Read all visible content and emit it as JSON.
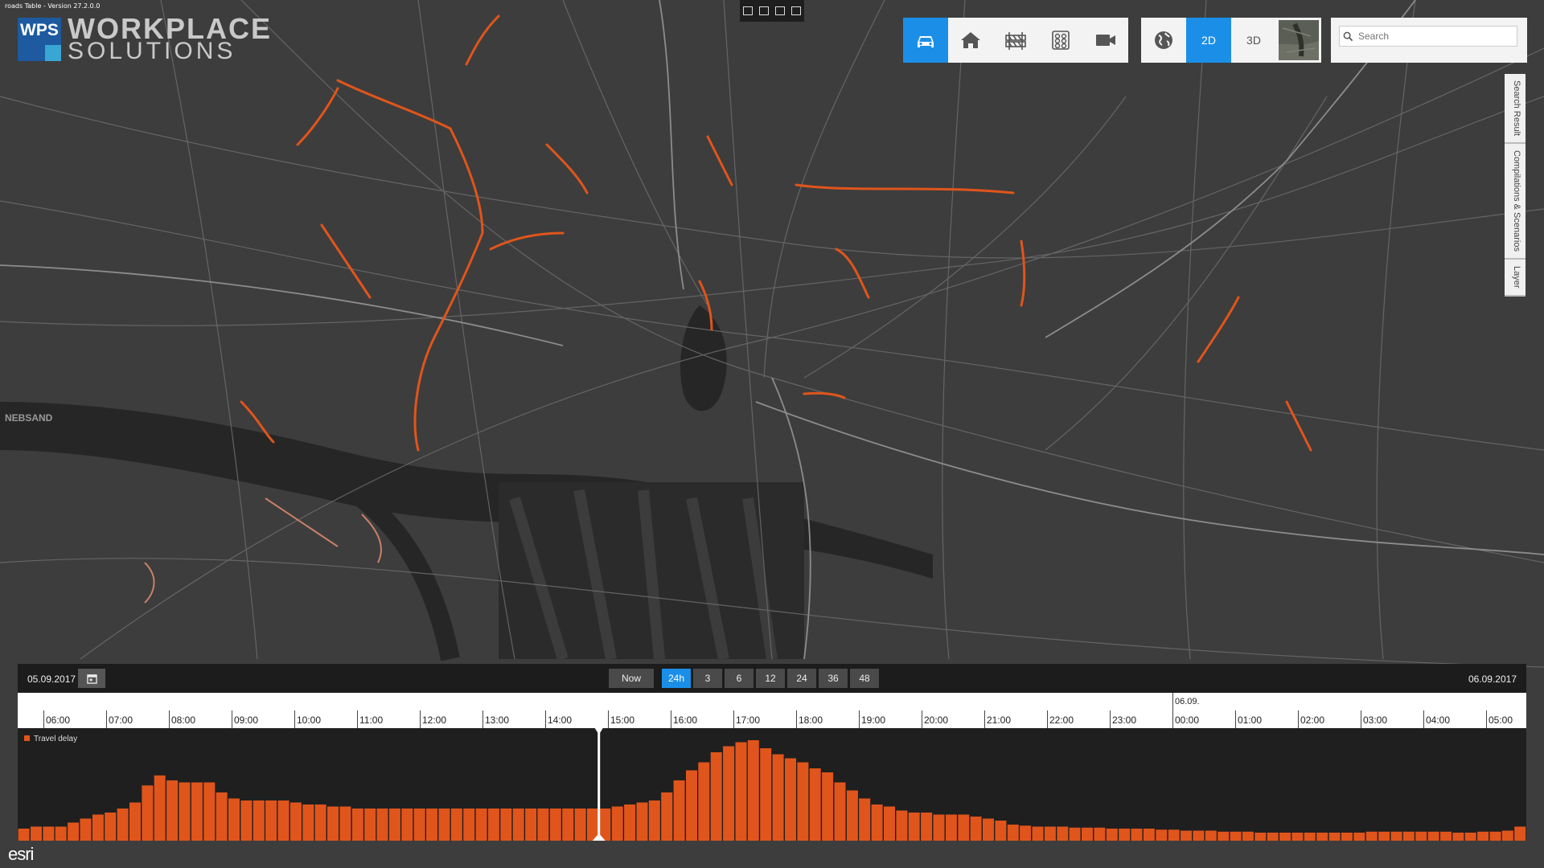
{
  "app": {
    "version_text": "roads Table - Version 27.2.0.0",
    "logo_mark": "WPS",
    "logo_line1": "WORKPLACE",
    "logo_line2": "SOLUTIONS"
  },
  "mini_tools": [
    "select-icon",
    "pointer-icon",
    "frame-icon",
    "move-icon"
  ],
  "toolbar1": [
    {
      "name": "car-icon",
      "active": true
    },
    {
      "name": "home-icon",
      "active": false
    },
    {
      "name": "roadwork-barrier-icon",
      "active": false
    },
    {
      "name": "traffic-light-icon",
      "active": false
    },
    {
      "name": "camera-icon",
      "active": false
    }
  ],
  "toolbar2": {
    "globe_icon": "globe-icon",
    "btn_2d": "2D",
    "btn_3d": "3D",
    "basemap_thumb": "satellite-thumbnail"
  },
  "search": {
    "placeholder": "Search",
    "value": ""
  },
  "side_tabs": [
    "Search Result",
    "Compilations & Scenarios",
    "Layer"
  ],
  "map_labels": [
    "NEBSAND"
  ],
  "timebar": {
    "date_start": "05.09.2017",
    "date_end": "06.09.2017",
    "ranges": [
      "Now",
      "24h",
      "3",
      "6",
      "12",
      "24",
      "36",
      "48"
    ],
    "active_range": "24h"
  },
  "ruler": {
    "hours": [
      "06:00",
      "07:00",
      "08:00",
      "09:00",
      "10:00",
      "11:00",
      "12:00",
      "13:00",
      "14:00",
      "15:00",
      "16:00",
      "17:00",
      "18:00",
      "19:00",
      "20:00",
      "21:00",
      "22:00",
      "23:00",
      "00:00",
      "01:00",
      "02:00",
      "03:00",
      "04:00",
      "05:00"
    ],
    "day_marker": "06.09."
  },
  "colors": {
    "accent": "#1b8fe8",
    "delay_bar": "#e0551b",
    "congestion": "#e0551b"
  },
  "chart_data": {
    "type": "bar",
    "legend": "Travel delay",
    "x_start": "05.09.2017 05:30",
    "x_step_minutes": 15,
    "ylim": [
      0,
      100
    ],
    "cursor_time": "17:15",
    "values": [
      12,
      14,
      14,
      14,
      18,
      22,
      26,
      28,
      32,
      38,
      55,
      65,
      60,
      58,
      58,
      58,
      48,
      42,
      40,
      40,
      40,
      40,
      38,
      36,
      36,
      34,
      34,
      32,
      32,
      32,
      32,
      32,
      32,
      32,
      32,
      32,
      32,
      32,
      32,
      32,
      32,
      32,
      32,
      32,
      32,
      32,
      32,
      32,
      34,
      36,
      38,
      40,
      48,
      60,
      70,
      78,
      88,
      94,
      98,
      100,
      92,
      86,
      82,
      78,
      72,
      68,
      58,
      50,
      42,
      36,
      34,
      30,
      28,
      28,
      26,
      26,
      26,
      24,
      22,
      20,
      16,
      15,
      14,
      14,
      14,
      13,
      13,
      13,
      12,
      12,
      12,
      12,
      11,
      11,
      10,
      10,
      10,
      9,
      9,
      9,
      8,
      8,
      8,
      8,
      8,
      8,
      8,
      8,
      8,
      9,
      9,
      9,
      9,
      9,
      9,
      9,
      8,
      8,
      9,
      9,
      10,
      14
    ]
  }
}
